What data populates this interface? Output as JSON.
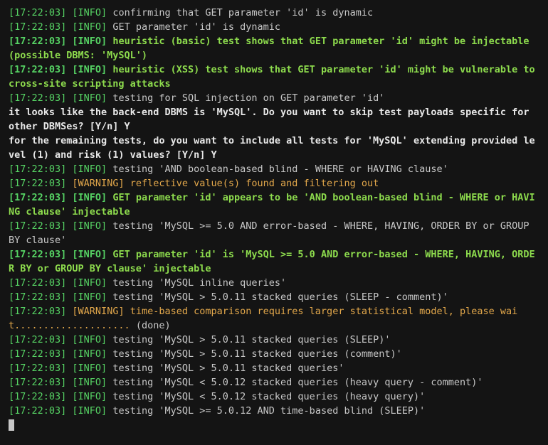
{
  "lines": [
    {
      "ts": "[17:22:03]",
      "lvl": "[INFO]",
      "lvlClass": "lvl-info",
      "msg": "confirming that GET parameter 'id' is dynamic",
      "style": "normal"
    },
    {
      "ts": "[17:22:03]",
      "lvl": "[INFO]",
      "lvlClass": "lvl-info",
      "msg": "GET parameter 'id' is dynamic",
      "style": "normal"
    },
    {
      "ts": "[17:22:03]",
      "lvl": "[INFO]",
      "lvlClass": "lvl-info",
      "msg": "heuristic (basic) test shows that GET parameter 'id' might be injectable (possible DBMS: 'MySQL')",
      "style": "bold-green"
    },
    {
      "ts": "[17:22:03]",
      "lvl": "[INFO]",
      "lvlClass": "lvl-info",
      "msg": "heuristic (XSS) test shows that GET parameter 'id' might be vulnerable to cross-site scripting attacks",
      "style": "bold-green"
    },
    {
      "ts": "[17:22:03]",
      "lvl": "[INFO]",
      "lvlClass": "lvl-info",
      "msg": "testing for SQL injection on GET parameter 'id'",
      "style": "normal"
    },
    {
      "raw": true,
      "msg": "it looks like the back-end DBMS is 'MySQL'. Do you want to skip test payloads specific for other DBMSes? [Y/n] Y",
      "style": "bold-white"
    },
    {
      "raw": true,
      "msg": "for the remaining tests, do you want to include all tests for 'MySQL' extending provided level (1) and risk (1) values? [Y/n] Y",
      "style": "bold-white"
    },
    {
      "ts": "[17:22:03]",
      "lvl": "[INFO]",
      "lvlClass": "lvl-info",
      "msg": "testing 'AND boolean-based blind - WHERE or HAVING clause'",
      "style": "normal"
    },
    {
      "ts": "[17:22:03]",
      "lvl": "[WARNING]",
      "lvlClass": "lvl-warn",
      "msg": "reflective value(s) found and filtering out",
      "style": "warn"
    },
    {
      "ts": "[17:22:03]",
      "lvl": "[INFO]",
      "lvlClass": "lvl-info",
      "msg": "GET parameter 'id' appears to be 'AND boolean-based blind - WHERE or HAVING clause' injectable",
      "style": "bold-green"
    },
    {
      "ts": "[17:22:03]",
      "lvl": "[INFO]",
      "lvlClass": "lvl-info",
      "msg": "testing 'MySQL >= 5.0 AND error-based - WHERE, HAVING, ORDER BY or GROUP BY clause'",
      "style": "normal"
    },
    {
      "ts": "[17:22:03]",
      "lvl": "[INFO]",
      "lvlClass": "lvl-info",
      "msg": "GET parameter 'id' is 'MySQL >= 5.0 AND error-based - WHERE, HAVING, ORDER BY or GROUP BY clause' injectable",
      "style": "bold-green"
    },
    {
      "ts": "[17:22:03]",
      "lvl": "[INFO]",
      "lvlClass": "lvl-info",
      "msg": "testing 'MySQL inline queries'",
      "style": "normal"
    },
    {
      "ts": "[17:22:03]",
      "lvl": "[INFO]",
      "lvlClass": "lvl-info",
      "msg": "testing 'MySQL > 5.0.11 stacked queries (SLEEP - comment)'",
      "style": "normal"
    },
    {
      "ts": "[17:22:03]",
      "lvl": "[WARNING]",
      "lvlClass": "lvl-warn",
      "msg": "time-based comparison requires larger statistical model, please wait.................... (done)",
      "style": "warn-mix"
    },
    {
      "ts": "[17:22:03]",
      "lvl": "[INFO]",
      "lvlClass": "lvl-info",
      "msg": "testing 'MySQL > 5.0.11 stacked queries (SLEEP)'",
      "style": "normal"
    },
    {
      "ts": "[17:22:03]",
      "lvl": "[INFO]",
      "lvlClass": "lvl-info",
      "msg": "testing 'MySQL > 5.0.11 stacked queries (comment)'",
      "style": "normal"
    },
    {
      "ts": "[17:22:03]",
      "lvl": "[INFO]",
      "lvlClass": "lvl-info",
      "msg": "testing 'MySQL > 5.0.11 stacked queries'",
      "style": "normal"
    },
    {
      "ts": "[17:22:03]",
      "lvl": "[INFO]",
      "lvlClass": "lvl-info",
      "msg": "testing 'MySQL < 5.0.12 stacked queries (heavy query - comment)'",
      "style": "normal"
    },
    {
      "ts": "[17:22:03]",
      "lvl": "[INFO]",
      "lvlClass": "lvl-info",
      "msg": "testing 'MySQL < 5.0.12 stacked queries (heavy query)'",
      "style": "normal"
    },
    {
      "ts": "[17:22:03]",
      "lvl": "[INFO]",
      "lvlClass": "lvl-info",
      "msg": "testing 'MySQL >= 5.0.12 AND time-based blind (SLEEP)'",
      "style": "normal"
    }
  ]
}
